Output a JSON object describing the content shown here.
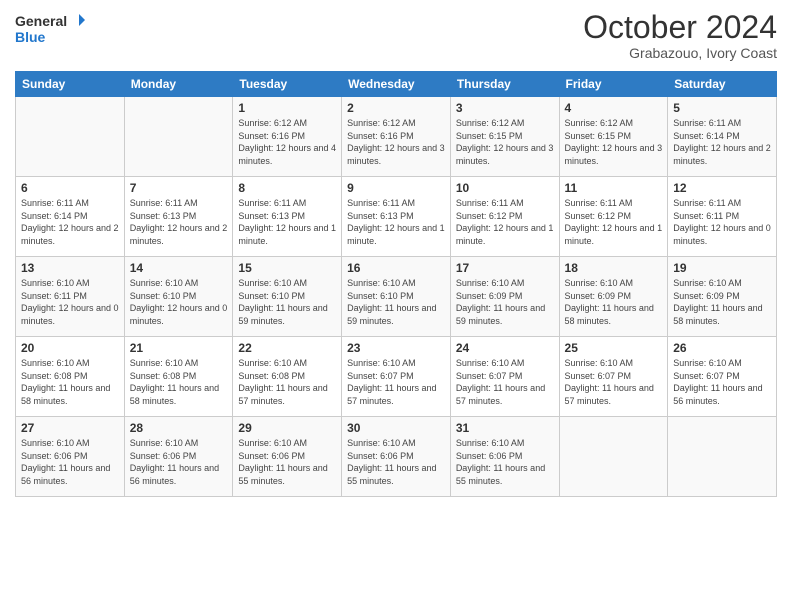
{
  "header": {
    "logo_line1": "General",
    "logo_line2": "Blue",
    "month": "October 2024",
    "location": "Grabazouo, Ivory Coast"
  },
  "weekdays": [
    "Sunday",
    "Monday",
    "Tuesday",
    "Wednesday",
    "Thursday",
    "Friday",
    "Saturday"
  ],
  "weeks": [
    [
      {
        "day": "",
        "sunrise": "",
        "sunset": "",
        "daylight": ""
      },
      {
        "day": "",
        "sunrise": "",
        "sunset": "",
        "daylight": ""
      },
      {
        "day": "1",
        "sunrise": "Sunrise: 6:12 AM",
        "sunset": "Sunset: 6:16 PM",
        "daylight": "Daylight: 12 hours and 4 minutes."
      },
      {
        "day": "2",
        "sunrise": "Sunrise: 6:12 AM",
        "sunset": "Sunset: 6:16 PM",
        "daylight": "Daylight: 12 hours and 3 minutes."
      },
      {
        "day": "3",
        "sunrise": "Sunrise: 6:12 AM",
        "sunset": "Sunset: 6:15 PM",
        "daylight": "Daylight: 12 hours and 3 minutes."
      },
      {
        "day": "4",
        "sunrise": "Sunrise: 6:12 AM",
        "sunset": "Sunset: 6:15 PM",
        "daylight": "Daylight: 12 hours and 3 minutes."
      },
      {
        "day": "5",
        "sunrise": "Sunrise: 6:11 AM",
        "sunset": "Sunset: 6:14 PM",
        "daylight": "Daylight: 12 hours and 2 minutes."
      }
    ],
    [
      {
        "day": "6",
        "sunrise": "Sunrise: 6:11 AM",
        "sunset": "Sunset: 6:14 PM",
        "daylight": "Daylight: 12 hours and 2 minutes."
      },
      {
        "day": "7",
        "sunrise": "Sunrise: 6:11 AM",
        "sunset": "Sunset: 6:13 PM",
        "daylight": "Daylight: 12 hours and 2 minutes."
      },
      {
        "day": "8",
        "sunrise": "Sunrise: 6:11 AM",
        "sunset": "Sunset: 6:13 PM",
        "daylight": "Daylight: 12 hours and 1 minute."
      },
      {
        "day": "9",
        "sunrise": "Sunrise: 6:11 AM",
        "sunset": "Sunset: 6:13 PM",
        "daylight": "Daylight: 12 hours and 1 minute."
      },
      {
        "day": "10",
        "sunrise": "Sunrise: 6:11 AM",
        "sunset": "Sunset: 6:12 PM",
        "daylight": "Daylight: 12 hours and 1 minute."
      },
      {
        "day": "11",
        "sunrise": "Sunrise: 6:11 AM",
        "sunset": "Sunset: 6:12 PM",
        "daylight": "Daylight: 12 hours and 1 minute."
      },
      {
        "day": "12",
        "sunrise": "Sunrise: 6:11 AM",
        "sunset": "Sunset: 6:11 PM",
        "daylight": "Daylight: 12 hours and 0 minutes."
      }
    ],
    [
      {
        "day": "13",
        "sunrise": "Sunrise: 6:10 AM",
        "sunset": "Sunset: 6:11 PM",
        "daylight": "Daylight: 12 hours and 0 minutes."
      },
      {
        "day": "14",
        "sunrise": "Sunrise: 6:10 AM",
        "sunset": "Sunset: 6:10 PM",
        "daylight": "Daylight: 12 hours and 0 minutes."
      },
      {
        "day": "15",
        "sunrise": "Sunrise: 6:10 AM",
        "sunset": "Sunset: 6:10 PM",
        "daylight": "Daylight: 11 hours and 59 minutes."
      },
      {
        "day": "16",
        "sunrise": "Sunrise: 6:10 AM",
        "sunset": "Sunset: 6:10 PM",
        "daylight": "Daylight: 11 hours and 59 minutes."
      },
      {
        "day": "17",
        "sunrise": "Sunrise: 6:10 AM",
        "sunset": "Sunset: 6:09 PM",
        "daylight": "Daylight: 11 hours and 59 minutes."
      },
      {
        "day": "18",
        "sunrise": "Sunrise: 6:10 AM",
        "sunset": "Sunset: 6:09 PM",
        "daylight": "Daylight: 11 hours and 58 minutes."
      },
      {
        "day": "19",
        "sunrise": "Sunrise: 6:10 AM",
        "sunset": "Sunset: 6:09 PM",
        "daylight": "Daylight: 11 hours and 58 minutes."
      }
    ],
    [
      {
        "day": "20",
        "sunrise": "Sunrise: 6:10 AM",
        "sunset": "Sunset: 6:08 PM",
        "daylight": "Daylight: 11 hours and 58 minutes."
      },
      {
        "day": "21",
        "sunrise": "Sunrise: 6:10 AM",
        "sunset": "Sunset: 6:08 PM",
        "daylight": "Daylight: 11 hours and 58 minutes."
      },
      {
        "day": "22",
        "sunrise": "Sunrise: 6:10 AM",
        "sunset": "Sunset: 6:08 PM",
        "daylight": "Daylight: 11 hours and 57 minutes."
      },
      {
        "day": "23",
        "sunrise": "Sunrise: 6:10 AM",
        "sunset": "Sunset: 6:07 PM",
        "daylight": "Daylight: 11 hours and 57 minutes."
      },
      {
        "day": "24",
        "sunrise": "Sunrise: 6:10 AM",
        "sunset": "Sunset: 6:07 PM",
        "daylight": "Daylight: 11 hours and 57 minutes."
      },
      {
        "day": "25",
        "sunrise": "Sunrise: 6:10 AM",
        "sunset": "Sunset: 6:07 PM",
        "daylight": "Daylight: 11 hours and 57 minutes."
      },
      {
        "day": "26",
        "sunrise": "Sunrise: 6:10 AM",
        "sunset": "Sunset: 6:07 PM",
        "daylight": "Daylight: 11 hours and 56 minutes."
      }
    ],
    [
      {
        "day": "27",
        "sunrise": "Sunrise: 6:10 AM",
        "sunset": "Sunset: 6:06 PM",
        "daylight": "Daylight: 11 hours and 56 minutes."
      },
      {
        "day": "28",
        "sunrise": "Sunrise: 6:10 AM",
        "sunset": "Sunset: 6:06 PM",
        "daylight": "Daylight: 11 hours and 56 minutes."
      },
      {
        "day": "29",
        "sunrise": "Sunrise: 6:10 AM",
        "sunset": "Sunset: 6:06 PM",
        "daylight": "Daylight: 11 hours and 55 minutes."
      },
      {
        "day": "30",
        "sunrise": "Sunrise: 6:10 AM",
        "sunset": "Sunset: 6:06 PM",
        "daylight": "Daylight: 11 hours and 55 minutes."
      },
      {
        "day": "31",
        "sunrise": "Sunrise: 6:10 AM",
        "sunset": "Sunset: 6:06 PM",
        "daylight": "Daylight: 11 hours and 55 minutes."
      },
      {
        "day": "",
        "sunrise": "",
        "sunset": "",
        "daylight": ""
      },
      {
        "day": "",
        "sunrise": "",
        "sunset": "",
        "daylight": ""
      }
    ]
  ]
}
